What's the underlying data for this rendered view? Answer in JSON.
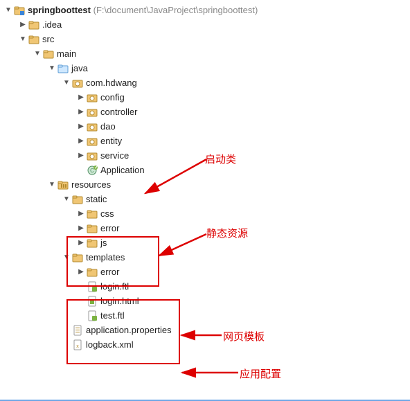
{
  "root": {
    "name": "springboottest",
    "path": "(F:\\document\\JavaProject\\springboottest)"
  },
  "tree": {
    "idea": ".idea",
    "src": "src",
    "main": "main",
    "java": "java",
    "pkg": "com.hdwang",
    "config": "config",
    "controller": "controller",
    "dao": "dao",
    "entity": "entity",
    "service": "service",
    "application": "Application",
    "resources": "resources",
    "static": "static",
    "css": "css",
    "error": "error",
    "js": "js",
    "templates": "templates",
    "terror": "error",
    "loginftl": "login.ftl",
    "loginhtml": "login.html",
    "testftl": "test.ftl",
    "appprops": "application.properties",
    "logback": "logback.xml"
  },
  "annotations": {
    "startup": "启动类",
    "static": "静态资源",
    "templates": "网页模板",
    "appconf": "应用配置"
  }
}
